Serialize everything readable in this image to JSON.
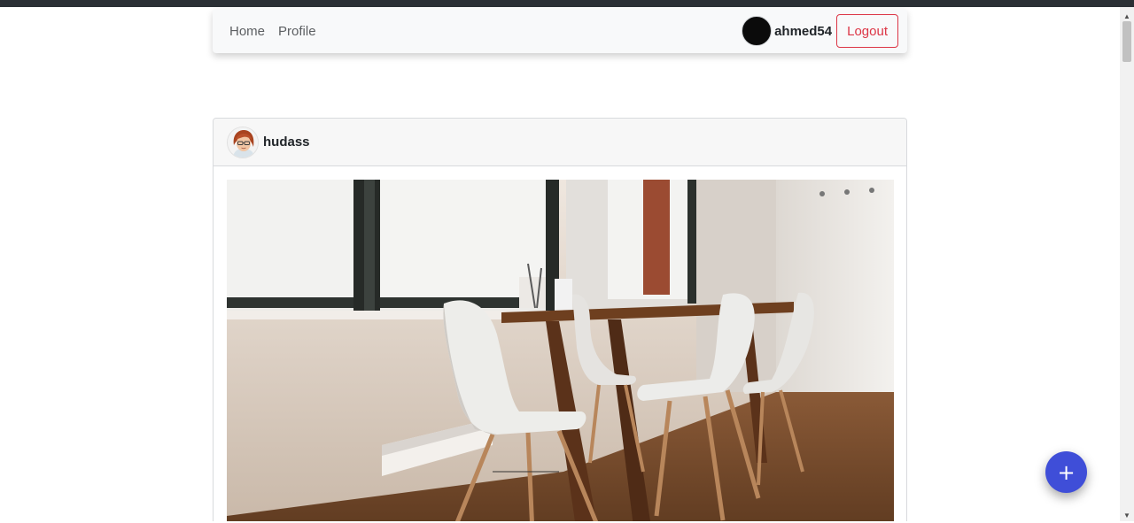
{
  "navbar": {
    "links": [
      {
        "label": "Home"
      },
      {
        "label": "Profile"
      }
    ],
    "username": "ahmed54",
    "logout_label": "Logout"
  },
  "post": {
    "author": "hudass"
  },
  "fab": {
    "label": "+"
  },
  "colors": {
    "navbar_bg": "#f8f9fa",
    "logout": "#dc3545",
    "fab": "#3f4ed8",
    "topbar": "#2b3035"
  },
  "icons": {
    "scroll_up": "scroll-up-arrow-icon",
    "scroll_down": "scroll-down-arrow-icon",
    "fab": "plus-icon"
  }
}
